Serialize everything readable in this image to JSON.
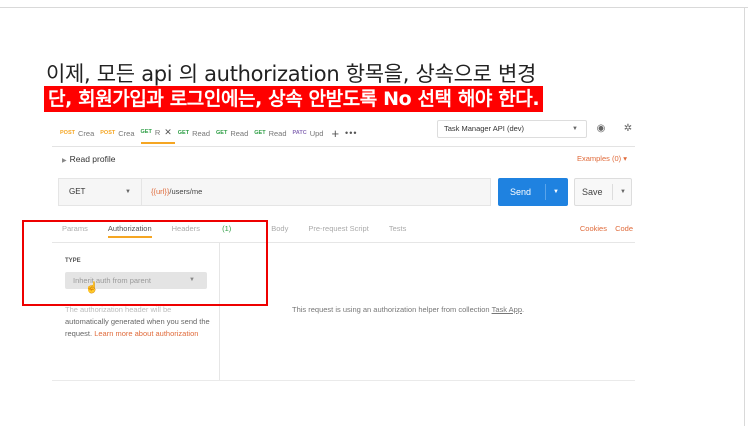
{
  "slide": {
    "line1": "이제, 모든 api 의 authorization 항목을, 상속으로 변경",
    "line2": "단, 회원가입과 로그인에는, 상속 안받도록 No 선택 해야 한다."
  },
  "postman": {
    "tabs": [
      {
        "method": "POST",
        "label": "Crea"
      },
      {
        "method": "POST",
        "label": "Crea"
      },
      {
        "method": "GET",
        "label": "R",
        "active": true
      },
      {
        "method": "GET",
        "label": "Read"
      },
      {
        "method": "GET",
        "label": "Read"
      },
      {
        "method": "GET",
        "label": "Read"
      },
      {
        "method": "PATC",
        "label": "Upd"
      }
    ],
    "environment": "Task Manager API (dev)",
    "request_name": "Read profile",
    "examples": "Examples (0)",
    "http_method": "GET",
    "url_var": "{{url}}",
    "url_path": "/users/me",
    "send_label": "Send",
    "save_label": "Save",
    "subtabs": {
      "params": "Params",
      "authorization": "Authorization",
      "headers": "Headers",
      "headers_count": "(1)",
      "body": "Body",
      "prerequest": "Pre-request Script",
      "tests": "Tests"
    },
    "cookies": "Cookies",
    "code": "Code",
    "type_label": "TYPE",
    "type_value": "Inherit auth from parent",
    "help_faded": "The authorization header will be",
    "help_text": "automatically generated when you send the request.",
    "help_link": "Learn more about authorization",
    "main_text": "This request is using an authorization helper from collection",
    "collection_link": "Task App",
    "main_text_end": "."
  },
  "colors": {
    "highlight_bg": "#ff0000",
    "accent_orange": "#e06b3b",
    "send_blue": "#1f82e0",
    "tab_active": "#f5a623"
  }
}
